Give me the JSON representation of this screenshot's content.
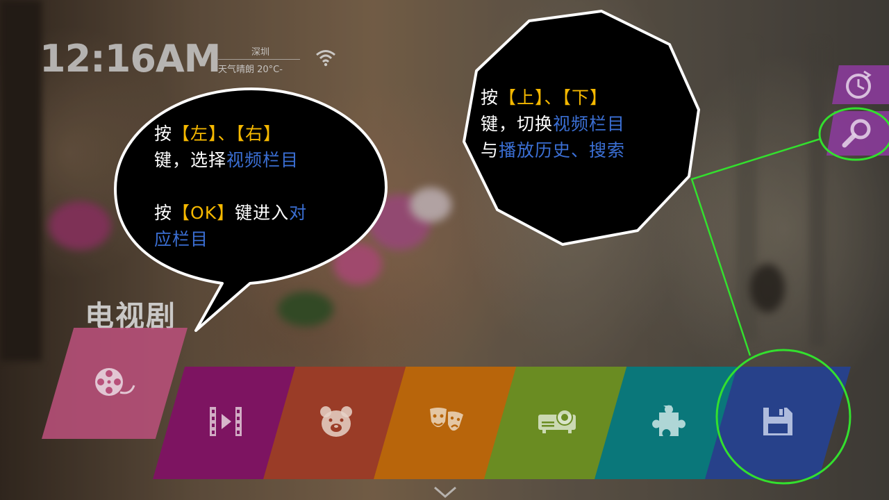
{
  "status": {
    "time": "12:16AM",
    "city": "深圳",
    "weather": "天气晴朗 20°C-",
    "wifi_icon": "wifi-icon"
  },
  "section": {
    "title": "电视剧"
  },
  "tiles": [
    {
      "id": "tv-series",
      "icon": "film-reel-icon",
      "color": "#b8507a"
    },
    {
      "id": "movies",
      "icon": "film-strip-play-icon",
      "color": "#7d1461"
    },
    {
      "id": "kids",
      "icon": "bear-icon",
      "color": "#9a3c27"
    },
    {
      "id": "variety",
      "icon": "theater-masks-icon",
      "color": "#b8650b"
    },
    {
      "id": "documentary",
      "icon": "projector-icon",
      "color": "#6a8c22"
    },
    {
      "id": "apps",
      "icon": "puzzle-piece-icon",
      "color": "#0a777a"
    },
    {
      "id": "local",
      "icon": "floppy-disk-icon",
      "color": "#27418a"
    }
  ],
  "side_buttons": [
    {
      "id": "history",
      "icon": "history-clock-icon",
      "color": "#8a3b9a"
    },
    {
      "id": "search",
      "icon": "search-icon",
      "color": "#8a3b9a"
    }
  ],
  "tips": {
    "left": {
      "l1_a": "按",
      "l1_b": "【左】、【右】",
      "l2_a": "键，选择",
      "l2_b": "视频栏目",
      "l3_a": "按",
      "l3_b": "【OK】",
      "l3_c": "键进入",
      "l3_d": "对",
      "l4_a": "应栏目"
    },
    "right": {
      "l1_a": "按",
      "l1_b": "【上】、【下】",
      "l2_a": "键，切换",
      "l2_b": "视频栏目",
      "l3_a": "与",
      "l3_b": "播放历史、搜索"
    }
  },
  "colors": {
    "highlight_ring": "#33e02e",
    "tip_yellow": "#f5b800",
    "tip_blue": "#3b6fd4"
  }
}
